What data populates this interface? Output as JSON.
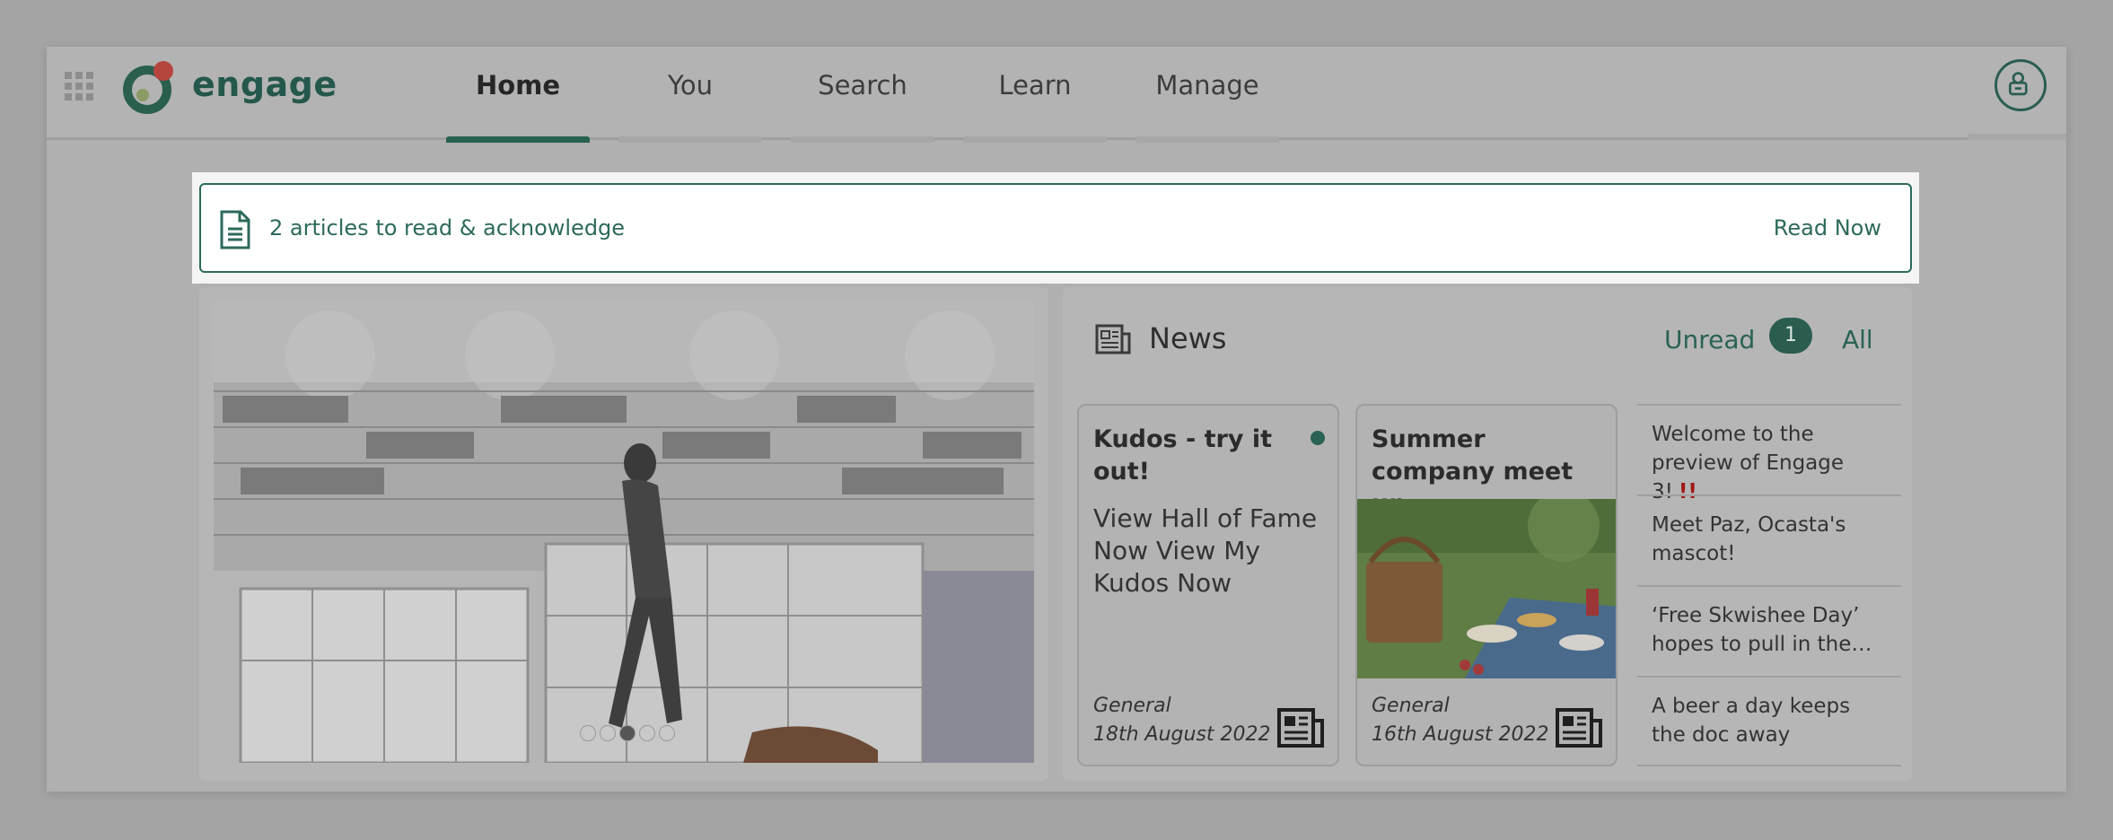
{
  "app": {
    "brand": "engage"
  },
  "nav": {
    "tabs": [
      {
        "label": "Home",
        "active": true
      },
      {
        "label": "You",
        "active": false
      },
      {
        "label": "Search",
        "active": false
      },
      {
        "label": "Learn",
        "active": false
      },
      {
        "label": "Manage",
        "active": false
      }
    ]
  },
  "banner": {
    "text": "2 articles to read & acknowledge",
    "action": "Read Now"
  },
  "carousel": {
    "slide_count": 5,
    "active_index": 2
  },
  "news": {
    "title": "News",
    "unread_label": "Unread",
    "unread_count": "1",
    "all_label": "All",
    "articles": [
      {
        "title": "Kudos - try it out!",
        "body": "View Hall of Fame Now   View My Kudos Now",
        "category": "General",
        "date": "18th August 2022",
        "unread": true
      },
      {
        "title": "Summer company meet up",
        "category": "General",
        "date": "16th August 2022",
        "unread": false
      }
    ],
    "list": [
      {
        "text": "Welcome to the preview of Engage 3!",
        "mark": "!!"
      },
      {
        "text": "Meet Paz, Ocasta's mascot!"
      },
      {
        "text": "‘Free Skwishee Day’ hopes to pull in the…"
      },
      {
        "text": "A beer a day keeps the doc away"
      }
    ]
  },
  "colors": {
    "brand_green": "#27614f",
    "alert_red": "#a01818",
    "overlay_gray": "#a4a4a4"
  }
}
